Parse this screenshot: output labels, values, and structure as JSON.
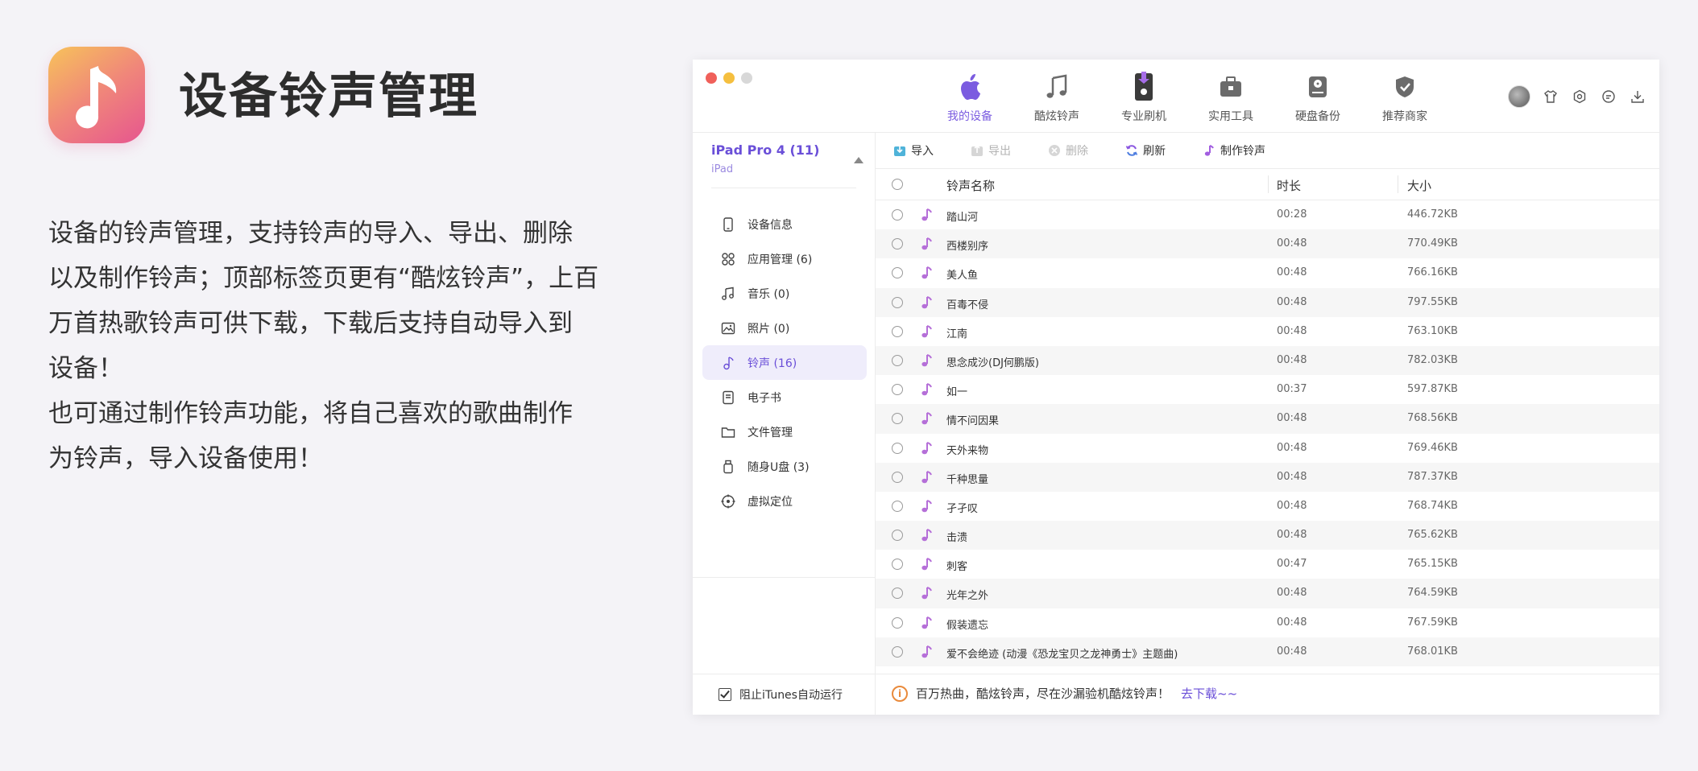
{
  "promo": {
    "title": "设备铃声管理",
    "desc_lines": [
      "设备的铃声管理，支持铃声的导入、导出、删除",
      "以及制作铃声；顶部标签页更有“酷炫铃声”，上百",
      "万首热歌铃声可供下载，下载后支持自动导入到",
      "设备！",
      "也可通过制作铃声功能，将自己喜欢的歌曲制作",
      "为铃声，导入设备使用！"
    ]
  },
  "nav": [
    {
      "label": "我的设备",
      "icon": "apple-icon",
      "active": true
    },
    {
      "label": "酷炫铃声",
      "icon": "music-note-icon",
      "active": false
    },
    {
      "label": "专业刷机",
      "icon": "flash-device-icon",
      "active": false
    },
    {
      "label": "实用工具",
      "icon": "toolbox-icon",
      "active": false
    },
    {
      "label": "硬盘备份",
      "icon": "hard-disk-icon",
      "active": false
    },
    {
      "label": "推荐商家",
      "icon": "shield-check-icon",
      "active": false
    }
  ],
  "device": {
    "name": "iPad Pro 4 (11)",
    "type": "iPad"
  },
  "sidebar": [
    {
      "label": "设备信息",
      "icon": "device-info-icon",
      "active": false
    },
    {
      "label": "应用管理 (6)",
      "icon": "apps-icon",
      "active": false
    },
    {
      "label": "音乐 (0)",
      "icon": "music-icon",
      "active": false
    },
    {
      "label": "照片 (0)",
      "icon": "photo-icon",
      "active": false
    },
    {
      "label": "铃声 (16)",
      "icon": "ringtone-icon",
      "active": true
    },
    {
      "label": "电子书",
      "icon": "ebook-icon",
      "active": false
    },
    {
      "label": "文件管理",
      "icon": "folder-icon",
      "active": false
    },
    {
      "label": "随身U盘 (3)",
      "icon": "usb-drive-icon",
      "active": false
    },
    {
      "label": "虚拟定位",
      "icon": "location-icon",
      "active": false
    }
  ],
  "block_itunes": "阻止iTunes自动运行",
  "toolbar": {
    "import": "导入",
    "export": "导出",
    "delete": "删除",
    "refresh": "刷新",
    "make": "制作铃声"
  },
  "table": {
    "headers": {
      "name": "铃声名称",
      "duration": "时长",
      "size": "大小"
    },
    "rows": [
      {
        "name": "踏山河",
        "duration": "00:28",
        "size": "446.72KB"
      },
      {
        "name": "西楼别序",
        "duration": "00:48",
        "size": "770.49KB"
      },
      {
        "name": "美人鱼",
        "duration": "00:48",
        "size": "766.16KB"
      },
      {
        "name": "百毒不侵",
        "duration": "00:48",
        "size": "797.55KB"
      },
      {
        "name": "江南",
        "duration": "00:48",
        "size": "763.10KB"
      },
      {
        "name": "思念成沙(DJ何鹏版)",
        "duration": "00:48",
        "size": "782.03KB"
      },
      {
        "name": "如一",
        "duration": "00:37",
        "size": "597.87KB"
      },
      {
        "name": "情不问因果",
        "duration": "00:48",
        "size": "768.56KB"
      },
      {
        "name": "天外来物",
        "duration": "00:48",
        "size": "769.46KB"
      },
      {
        "name": "千种思量",
        "duration": "00:48",
        "size": "787.37KB"
      },
      {
        "name": "孑孑叹",
        "duration": "00:48",
        "size": "768.74KB"
      },
      {
        "name": "击溃",
        "duration": "00:48",
        "size": "765.62KB"
      },
      {
        "name": "刺客",
        "duration": "00:47",
        "size": "765.15KB"
      },
      {
        "name": "光年之外",
        "duration": "00:48",
        "size": "764.59KB"
      },
      {
        "name": "假装遗忘",
        "duration": "00:48",
        "size": "767.59KB"
      },
      {
        "name": "爱不会绝迹 (动漫《恐龙宝贝之龙神勇士》主题曲)",
        "duration": "00:48",
        "size": "768.01KB"
      }
    ]
  },
  "banner": {
    "text": "百万热曲，酷炫铃声，尽在沙漏验机酷炫铃声！",
    "link": "去下载~~"
  },
  "colors": {
    "accent": "#6a4fd8",
    "note": "#b56fd8",
    "warning": "#e98a3b"
  }
}
